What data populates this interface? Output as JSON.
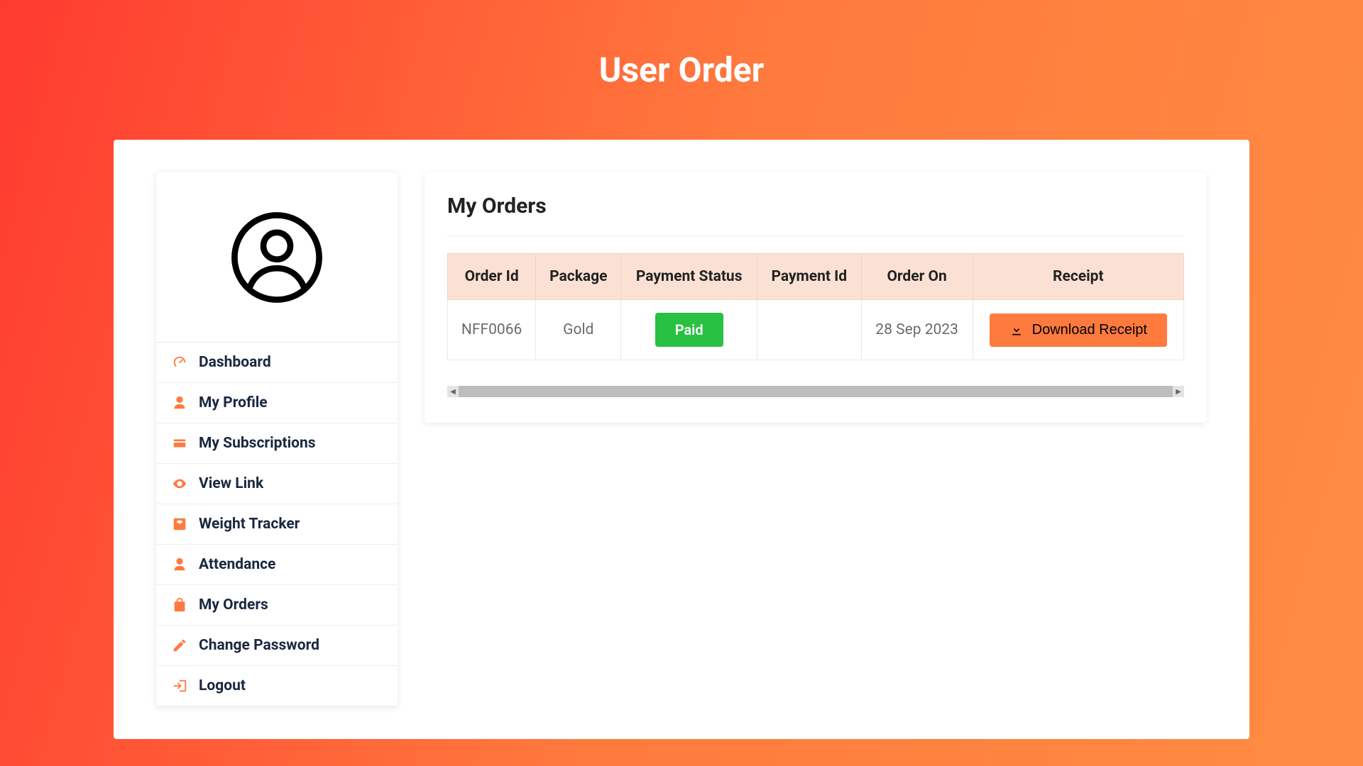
{
  "header": {
    "title": "User Order"
  },
  "sidebar": {
    "items": [
      {
        "label": "Dashboard",
        "icon": "gauge-icon"
      },
      {
        "label": "My Profile",
        "icon": "user-icon"
      },
      {
        "label": "My Subscriptions",
        "icon": "card-icon"
      },
      {
        "label": "View Link",
        "icon": "eye-icon"
      },
      {
        "label": "Weight Tracker",
        "icon": "scale-icon"
      },
      {
        "label": "Attendance",
        "icon": "user-icon"
      },
      {
        "label": "My Orders",
        "icon": "bag-icon"
      },
      {
        "label": "Change Password",
        "icon": "pencil-icon"
      },
      {
        "label": "Logout",
        "icon": "logout-icon"
      }
    ]
  },
  "orders": {
    "title": "My Orders",
    "columns": {
      "order_id": "Order Id",
      "package": "Package",
      "payment_status": "Payment Status",
      "payment_id": "Payment Id",
      "order_on": "Order On",
      "receipt": "Receipt"
    },
    "rows": [
      {
        "order_id": "NFF0066",
        "package": "Gold",
        "payment_status": "Paid",
        "payment_id": "",
        "order_on": "28 Sep 2023",
        "receipt_label": "Download Receipt"
      }
    ]
  },
  "colors": {
    "accent": "#ff7a3d",
    "success": "#28c141"
  }
}
